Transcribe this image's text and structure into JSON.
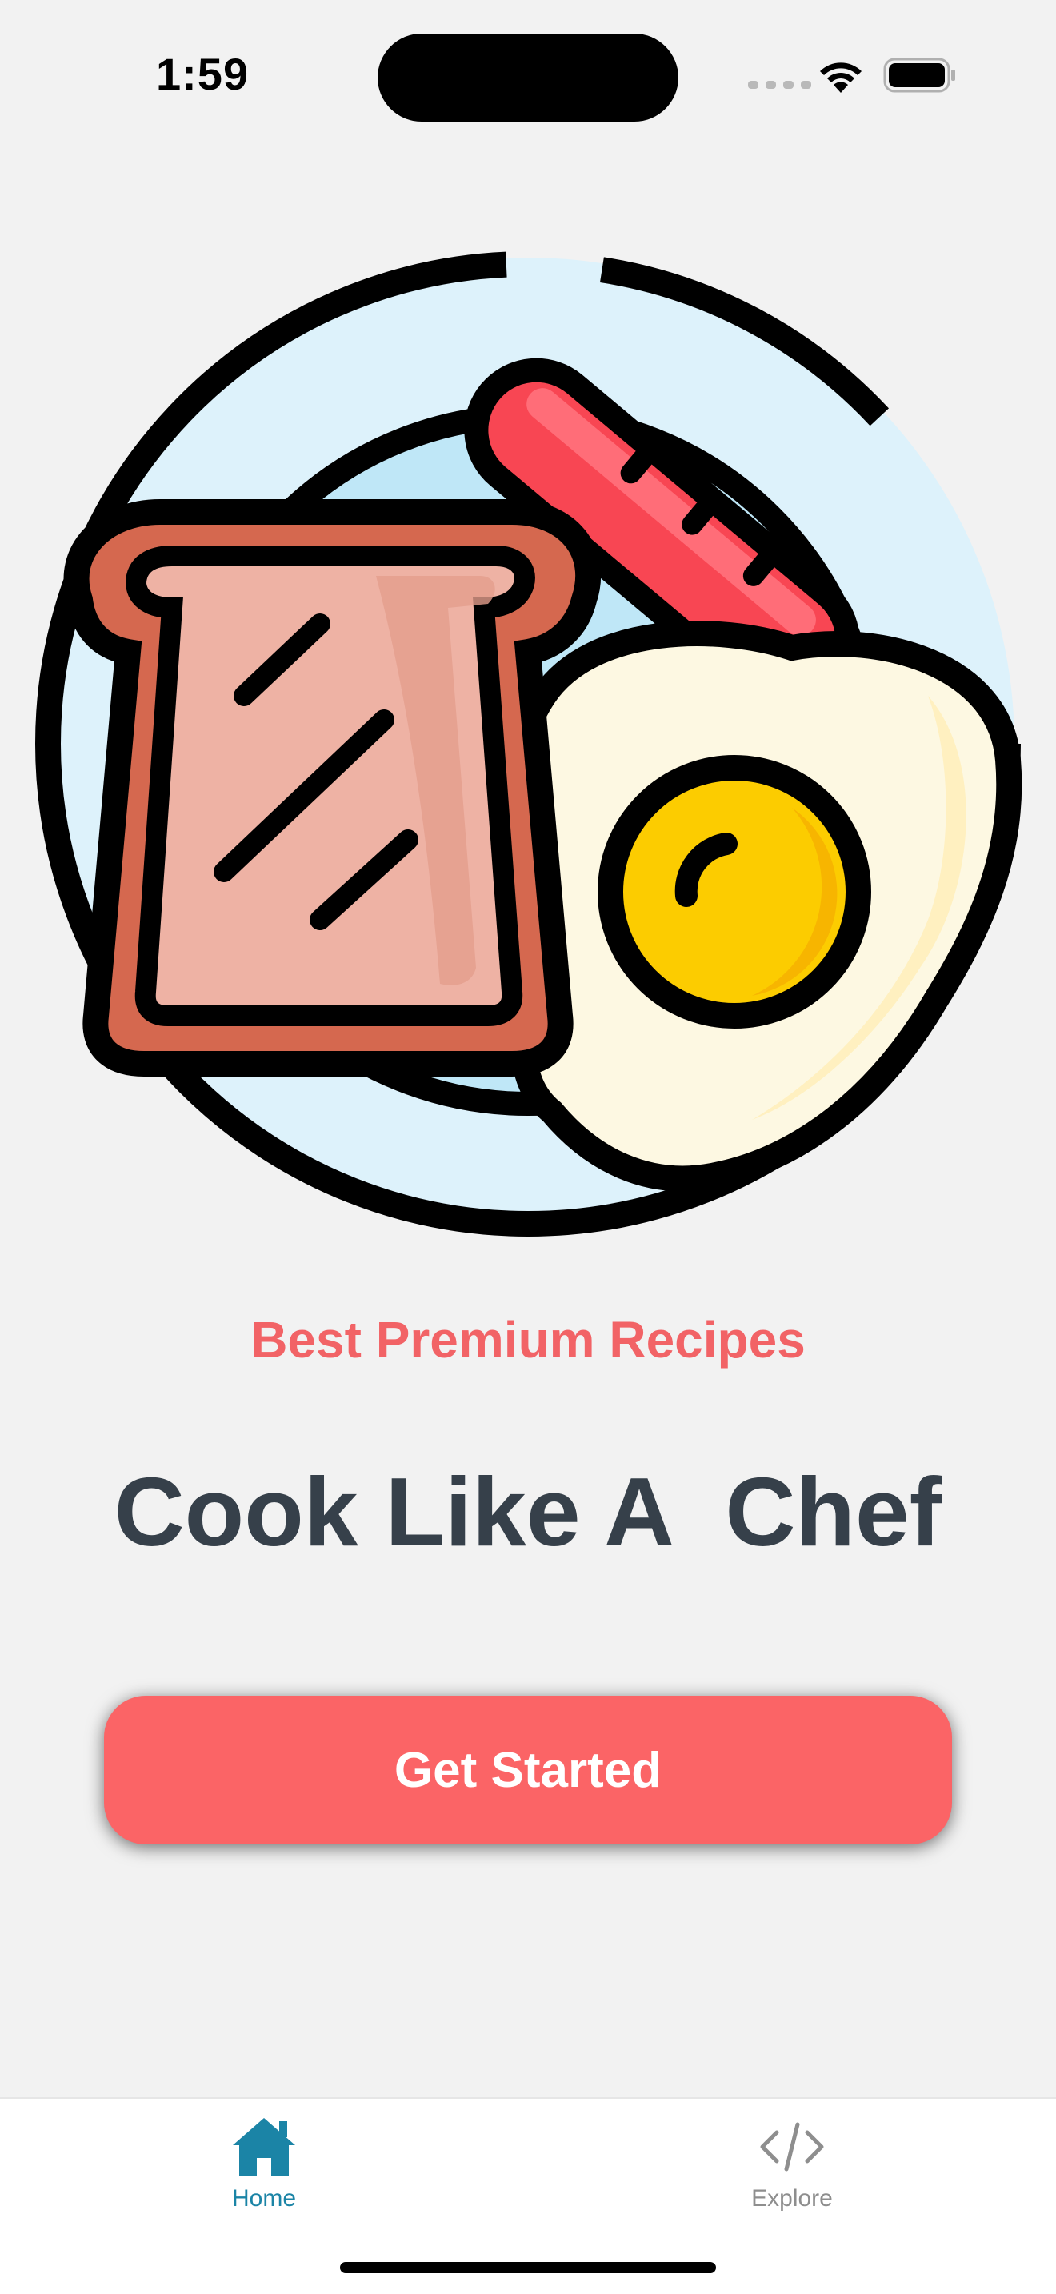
{
  "status_bar": {
    "time": "1:59",
    "icons": [
      "signal-icon",
      "wifi-icon",
      "battery-icon"
    ]
  },
  "hero": {
    "icon": "breakfast-plate-illustration",
    "colors": {
      "plate": "#ddf2fb",
      "toast_crust": "#d5684f",
      "toast_inner": "#eeb2a4",
      "sausage": "#f84653",
      "egg_white": "#fdf8e2",
      "yolk": "#fccc00",
      "outline": "#000000"
    }
  },
  "content": {
    "subtitle": "Best Premium Recipes",
    "title": "Cook Like A  Chef",
    "cta_label": "Get Started"
  },
  "tab_bar": {
    "tabs": [
      {
        "label": "Home",
        "icon": "home-icon",
        "active": true
      },
      {
        "label": "Explore",
        "icon": "code-icon",
        "active": false
      }
    ]
  },
  "colors": {
    "accent": "#fb6466",
    "subtitle": "#f26366",
    "title": "#36404a",
    "tab_active": "#1b84a6",
    "tab_inactive": "#8e8e8e",
    "background": "#f2f2f2"
  }
}
